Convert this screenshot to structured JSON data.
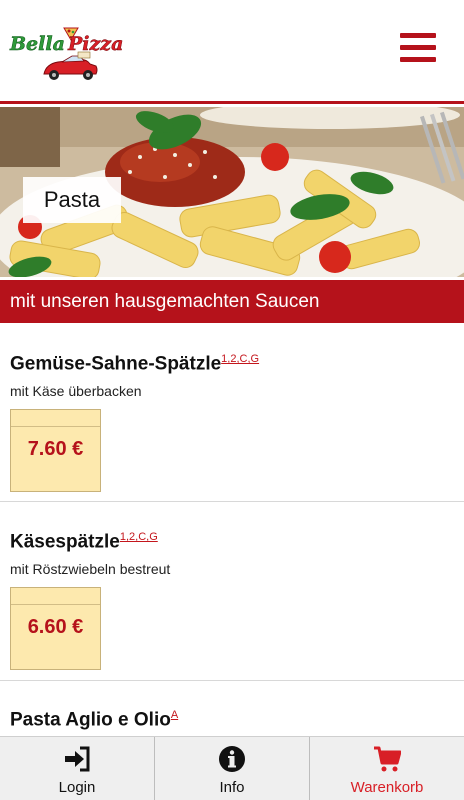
{
  "header": {
    "logo_text": "Bella Pizza",
    "menu_icon": "hamburger-menu-icon",
    "brand_color": "#b5121b"
  },
  "hero": {
    "category_label": "Pasta"
  },
  "banner": {
    "text": "mit unseren hausgemachten Saucen"
  },
  "items": [
    {
      "name": "Gemüse-Sahne-Spätzle",
      "allergens": "1,2,C,G",
      "description": "mit Käse überbacken",
      "price": "7.60 €"
    },
    {
      "name": "Käsespätzle",
      "allergens": "1,2,C,G",
      "description": "mit Röstzwiebeln bestreut",
      "price": "6.60 €"
    },
    {
      "name": "Pasta Aglio e Olio",
      "allergens": "A",
      "description": "",
      "price": ""
    }
  ],
  "bottom_nav": {
    "login_label": "Login",
    "login_icon": "sign-in-icon",
    "info_label": "Info",
    "info_icon": "info-circle-icon",
    "cart_label": "Warenkorb",
    "cart_icon": "shopping-cart-icon",
    "active_color": "#d81f26"
  }
}
